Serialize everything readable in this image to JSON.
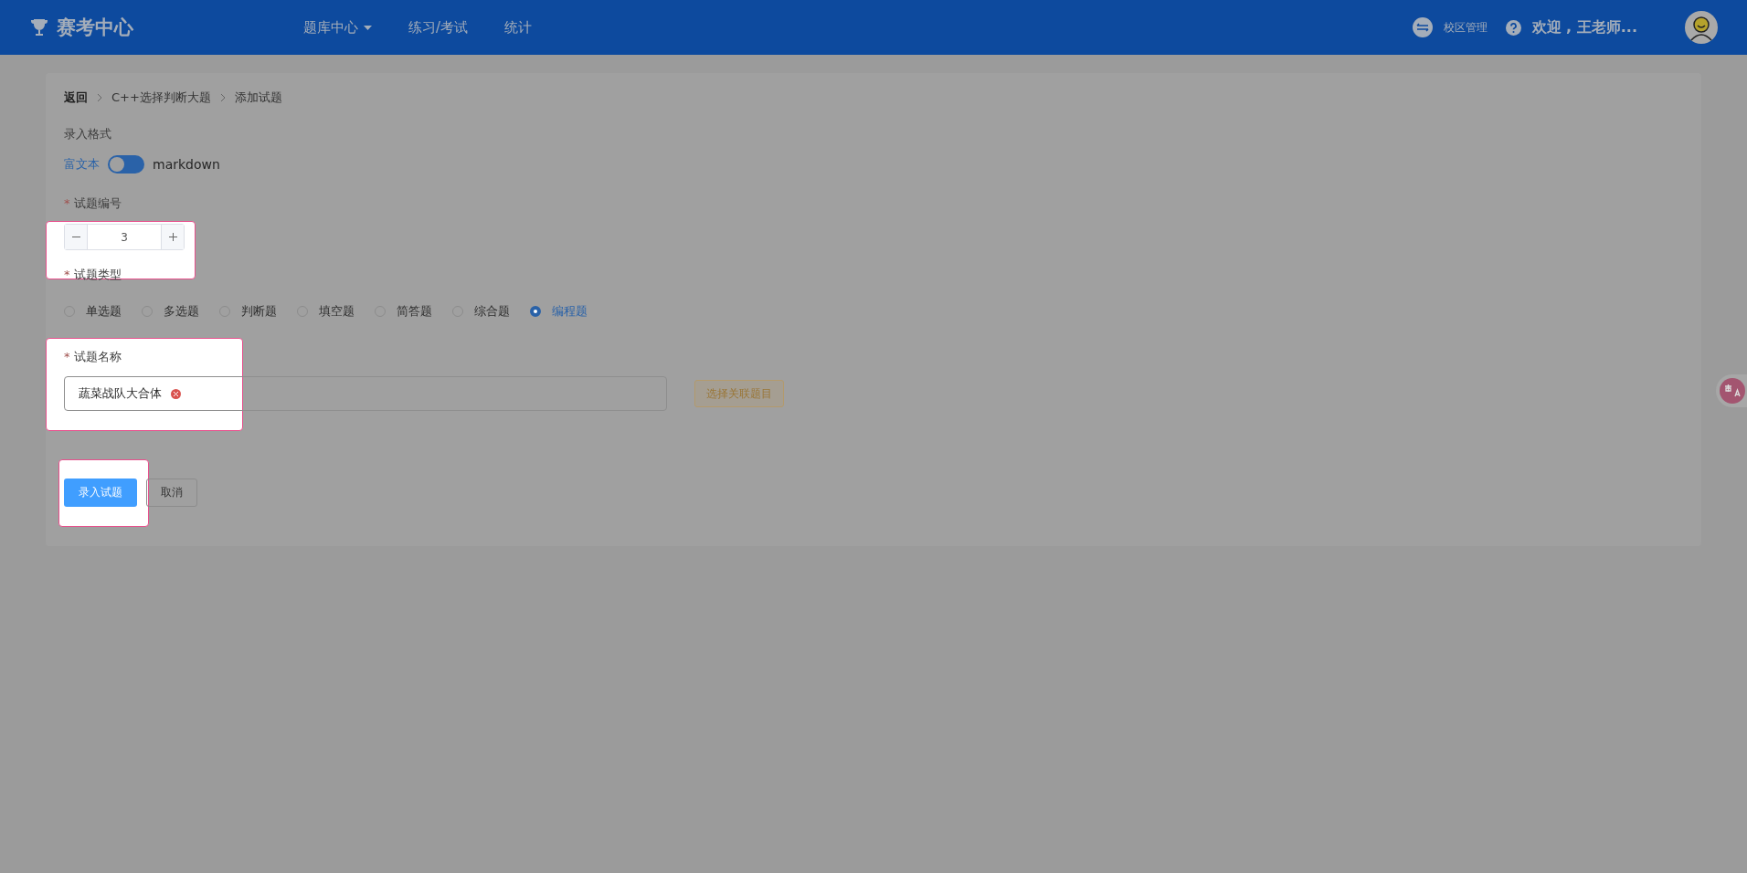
{
  "header": {
    "logo": "赛考中心",
    "nav": [
      {
        "label": "题库中心",
        "dropdown": true
      },
      {
        "label": "练习/考试",
        "dropdown": false
      },
      {
        "label": "统计",
        "dropdown": false
      }
    ],
    "campus": "校区管理",
    "welcome": "欢迎 , 王老师..."
  },
  "breadcrumb": [
    "返回",
    "C++选择判断大题",
    "添加试题"
  ],
  "format": {
    "label": "录入格式",
    "options": [
      {
        "label": "富文本",
        "selected": true
      },
      {
        "label": "markdown",
        "selected": false
      }
    ]
  },
  "number": {
    "label": "试题编号",
    "required_mark": "*",
    "value": "3",
    "highlighted": true
  },
  "type": {
    "label": "试题类型",
    "required_mark": "*",
    "options": [
      {
        "label": "单选题",
        "selected": false
      },
      {
        "label": "多选题",
        "selected": false
      },
      {
        "label": "判断题",
        "selected": false
      },
      {
        "label": "填空题",
        "selected": false
      },
      {
        "label": "简答题",
        "selected": false
      },
      {
        "label": "综合题",
        "selected": false
      },
      {
        "label": "编程题",
        "selected": true
      }
    ]
  },
  "name": {
    "label": "试题名称",
    "required_mark": "*",
    "value": "蔬菜战队大合体",
    "highlighted": true,
    "link_button": "选择关联题目"
  },
  "actions": {
    "submit": "录入试题",
    "submit_highlighted": true,
    "cancel": "取消"
  }
}
